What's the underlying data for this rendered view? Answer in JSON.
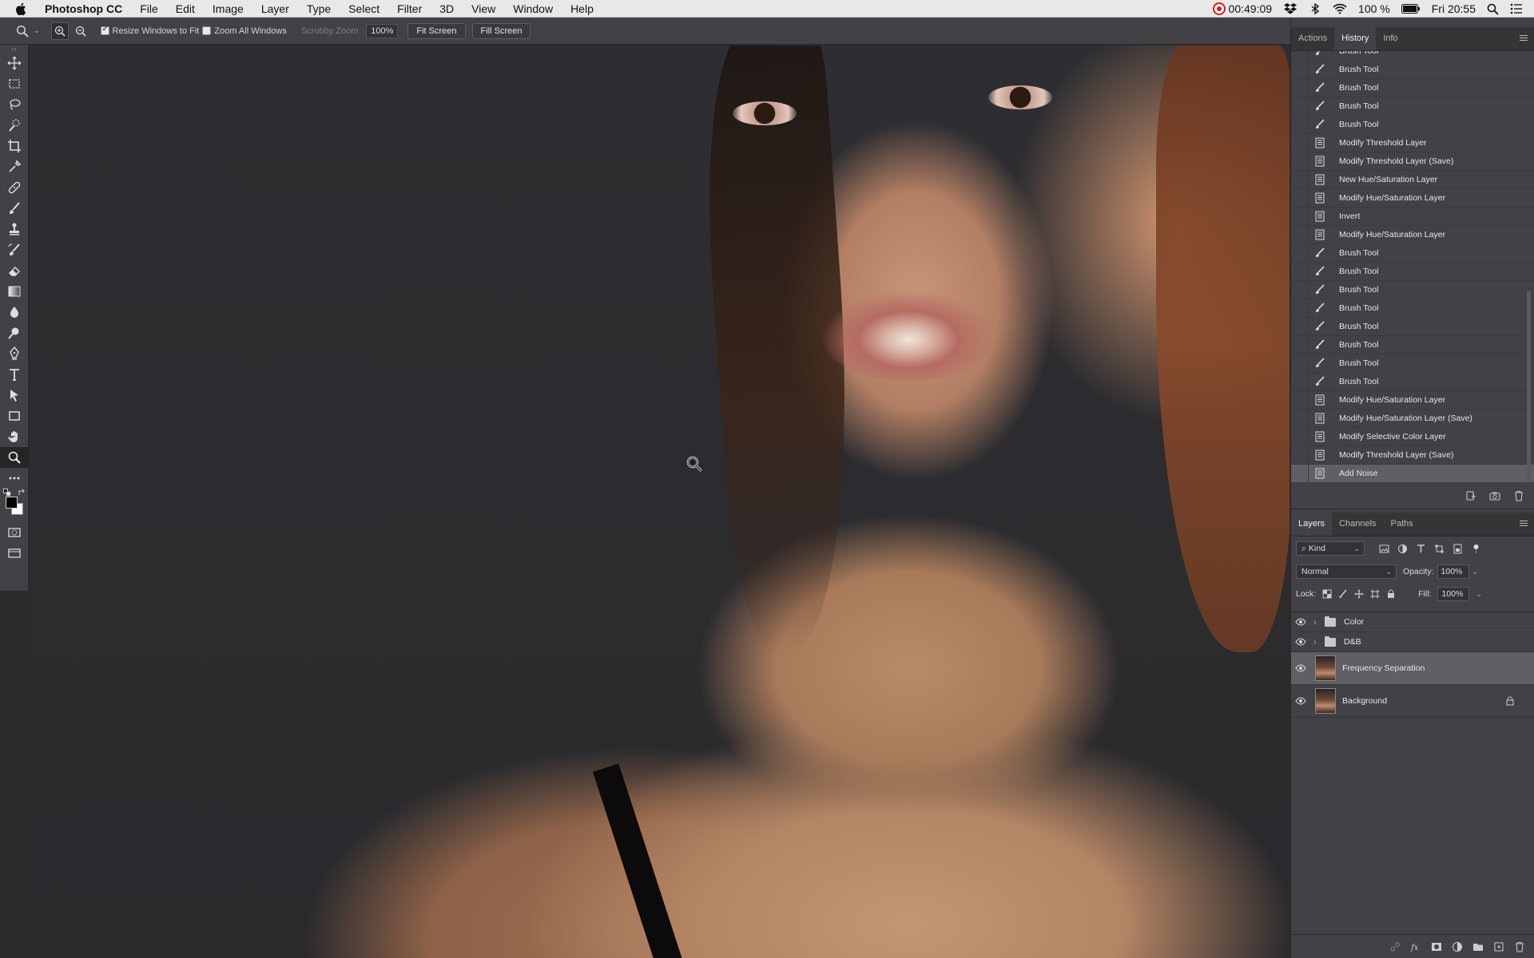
{
  "menubar": {
    "app_name": "Photoshop CC",
    "menus": [
      "File",
      "Edit",
      "Image",
      "Layer",
      "Type",
      "Select",
      "Filter",
      "3D",
      "View",
      "Window",
      "Help"
    ],
    "recording_time": "00:49:09",
    "battery": "100 %",
    "clock": "Fri 20:55"
  },
  "options": {
    "resize_windows_label": "Resize Windows to Fit",
    "resize_windows_checked": true,
    "zoom_all_label": "Zoom All Windows",
    "zoom_all_checked": false,
    "scrubby_zoom_label": "Scrubby Zoom",
    "zoom_value": "100%",
    "fit_screen_label": "Fit Screen",
    "fill_screen_label": "Fill Screen"
  },
  "history": {
    "tabs": [
      "Actions",
      "History",
      "Info"
    ],
    "active_tab": "History",
    "items": [
      {
        "label": "Brush Tool",
        "icon": "brush"
      },
      {
        "label": "Brush Tool",
        "icon": "brush"
      },
      {
        "label": "Brush Tool",
        "icon": "brush"
      },
      {
        "label": "Brush Tool",
        "icon": "brush"
      },
      {
        "label": "Brush Tool",
        "icon": "brush"
      },
      {
        "label": "Modify Threshold Layer",
        "icon": "doc"
      },
      {
        "label": "Modify Threshold Layer (Save)",
        "icon": "doc"
      },
      {
        "label": "New Hue/Saturation Layer",
        "icon": "doc"
      },
      {
        "label": "Modify Hue/Saturation Layer",
        "icon": "doc"
      },
      {
        "label": "Invert",
        "icon": "doc"
      },
      {
        "label": "Modify Hue/Saturation Layer",
        "icon": "doc"
      },
      {
        "label": "Brush Tool",
        "icon": "brush"
      },
      {
        "label": "Brush Tool",
        "icon": "brush"
      },
      {
        "label": "Brush Tool",
        "icon": "brush"
      },
      {
        "label": "Brush Tool",
        "icon": "brush"
      },
      {
        "label": "Brush Tool",
        "icon": "brush"
      },
      {
        "label": "Brush Tool",
        "icon": "brush"
      },
      {
        "label": "Brush Tool",
        "icon": "brush"
      },
      {
        "label": "Brush Tool",
        "icon": "brush"
      },
      {
        "label": "Modify Hue/Saturation Layer",
        "icon": "doc"
      },
      {
        "label": "Modify Hue/Saturation Layer (Save)",
        "icon": "doc"
      },
      {
        "label": "Modify Selective Color Layer",
        "icon": "doc"
      },
      {
        "label": "Modify Threshold Layer (Save)",
        "icon": "doc"
      },
      {
        "label": "Add Noise",
        "icon": "doc",
        "selected": true
      }
    ]
  },
  "layers": {
    "tabs": [
      "Layers",
      "Channels",
      "Paths"
    ],
    "active_tab": "Layers",
    "filter_kind": "Kind",
    "blend_mode": "Normal",
    "opacity_label": "Opacity:",
    "opacity_value": "100%",
    "lock_label": "Lock:",
    "fill_label": "Fill:",
    "fill_value": "100%",
    "items": [
      {
        "name": "Color",
        "type": "group",
        "visible": true
      },
      {
        "name": "D&B",
        "type": "group",
        "visible": true
      },
      {
        "name": "Frequency Separation",
        "type": "pixel",
        "visible": true,
        "selected": true
      },
      {
        "name": "Background",
        "type": "pixel",
        "visible": true,
        "locked": true
      }
    ]
  },
  "colors": {
    "foreground": "#050505",
    "background": "#ffffff"
  }
}
